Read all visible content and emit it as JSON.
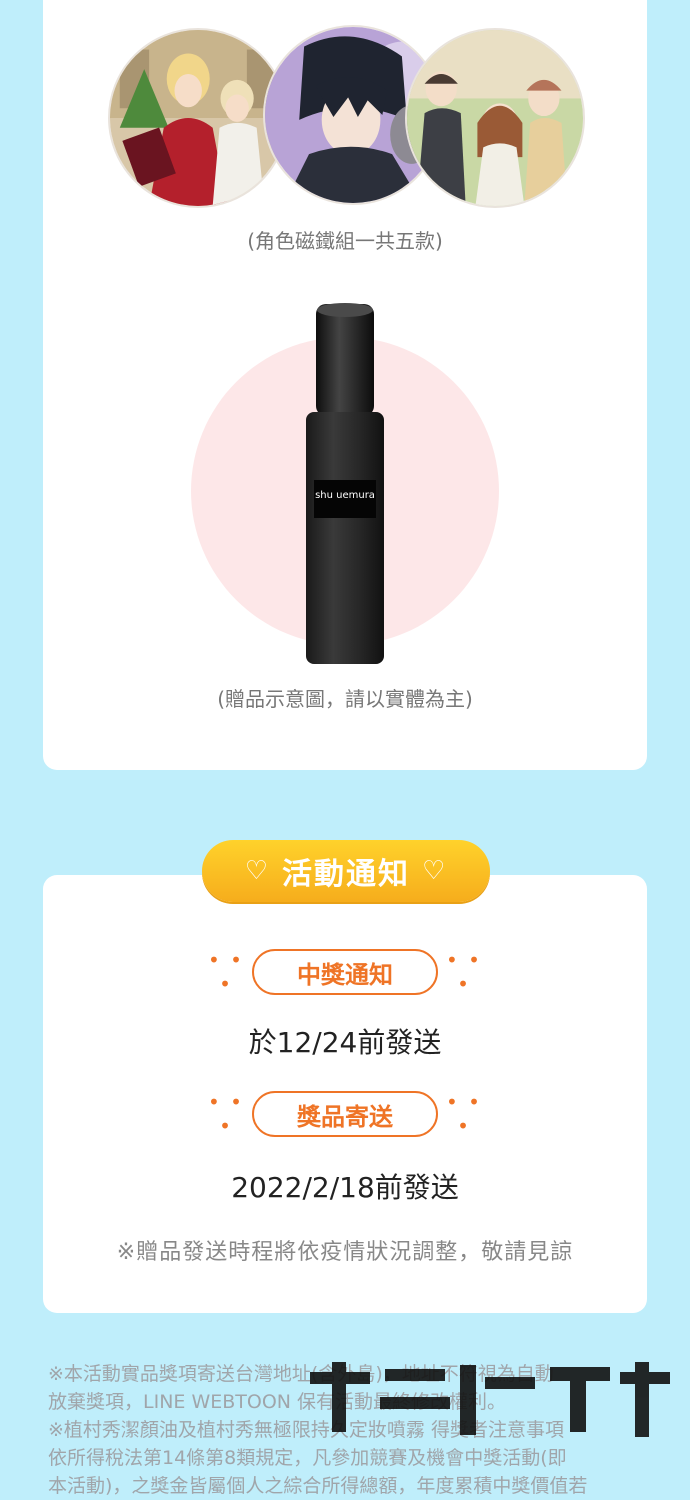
{
  "prizes": {
    "magnet_caption": "(角色磁鐵組一共五款)",
    "bottle_label": "shu uemura",
    "bottle_caption": "(贈品示意圖，請以實體為主)"
  },
  "notice": {
    "badge_heart_left": "♡",
    "badge_title": "活動通知",
    "badge_heart_right": "♡",
    "dots_left": "• • •",
    "dots_right": "• • •",
    "win_label": "中獎通知",
    "win_value": "於12/24前發送",
    "ship_label": "獎品寄送",
    "ship_value": "2022/2/18前發送",
    "remark": "※贈品發送時程將依疫情狀況調整，敬請見諒"
  },
  "terms": [
    "※本活動實品獎項寄送台灣地址(含外島)，地址不符視為自動",
    "放棄獎項，LINE WEBTOON 保有活動最終修改權利。",
    "※植村秀潔顏油及植村秀無極限持久定妝噴霧 得獎者注意事項",
    "依所得稅法第14條第8類規定，凡參加競賽及機會中獎活動(即",
    "本活動)，之獎金皆屬個人之綜合所得總額，年度累積中獎價值若"
  ],
  "colors": {
    "background": "#bfeefb",
    "accent_orange": "#ef7426",
    "badge_yellow": "#f6ad1c",
    "pink_circle": "#fde7e8"
  }
}
